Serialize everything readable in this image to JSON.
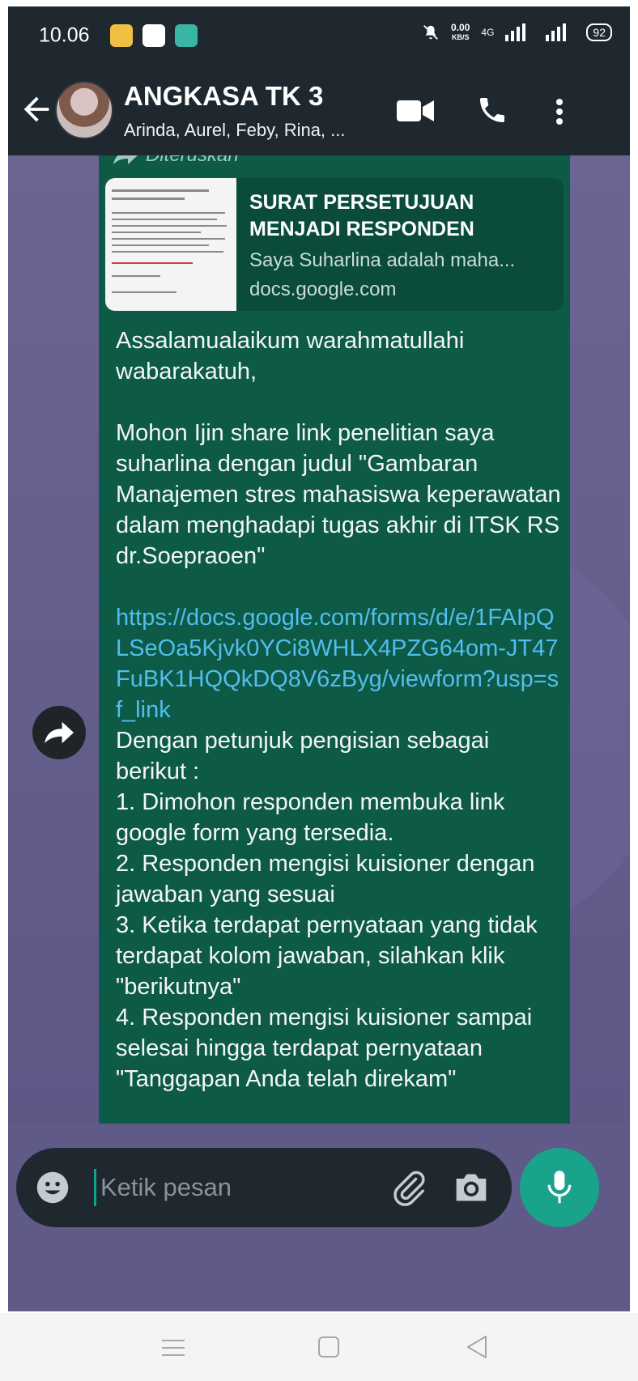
{
  "status_bar": {
    "time": "10.06",
    "net_speed_value": "0.00",
    "net_speed_unit": "KB/S",
    "network": "4G",
    "battery": "92"
  },
  "header": {
    "title": "ANGKASA TK 3",
    "subtitle": "Arinda, Aurel, Feby, Rina, ..."
  },
  "message": {
    "forwarded_label": "Diteruskan",
    "preview": {
      "title": "SURAT PERSETUJUAN MENJADI RESPONDEN",
      "description": "Saya Suharlina adalah maha...",
      "domain": "docs.google.com"
    },
    "text_before_link": "Assalamualaikum warahmatullahi wabarakatuh,\n\nMohon Ijin share link penelitian saya suharlina dengan judul \"Gambaran Manajemen stres mahasiswa keperawatan dalam menghadapi tugas akhir di ITSK RS dr.Soepraoen\"\n\n",
    "link": "https://docs.google.com/forms/d/e/1FAIpQLSeOa5Kjvk0YCi8WHLX4PZG64om-JT47FuBK1HQQkDQ8V6zByg/viewform?usp=sf_link",
    "text_after_link": "\nDengan petunjuk pengisian sebagai berikut :\n1. Dimohon responden membuka link google form yang tersedia.\n2. Responden mengisi kuisioner dengan jawaban yang sesuai\n3. Ketika terdapat pernyataan yang tidak terdapat kolom jawaban, silahkan klik \"berikutnya\"\n4. Responden mengisi kuisioner sampai selesai hingga terdapat pernyataan \"Tanggapan Anda telah direkam\""
  },
  "composer": {
    "placeholder": "Ketik pesan"
  },
  "colors": {
    "header_bg": "#1e282e",
    "bubble_bg": "#0d5a47",
    "accent": "#1aa38b",
    "link": "#53bdeb"
  },
  "icons": [
    "back-arrow-icon",
    "video-call-icon",
    "phone-icon",
    "more-vert-icon",
    "forward-icon",
    "emoji-icon",
    "attach-icon",
    "camera-icon",
    "mic-icon"
  ]
}
